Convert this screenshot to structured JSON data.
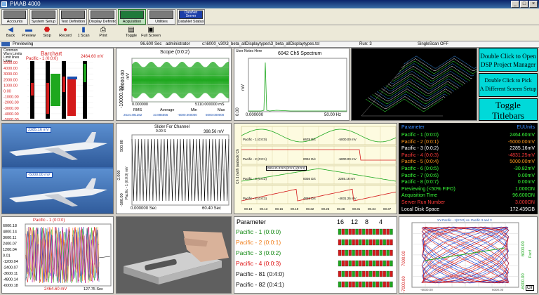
{
  "window": {
    "title": "PIAAB 4000",
    "minimize": "_",
    "maximize": "□",
    "close": "×"
  },
  "nav_buttons": [
    {
      "label": "Accounts"
    },
    {
      "label": "System Setup"
    },
    {
      "label": "Test Definition"
    },
    {
      "label": "Display Definition"
    },
    {
      "label": "Acquisition"
    },
    {
      "label": "Utilities"
    },
    {
      "label": "DataNet Status",
      "badge": "DataNet Server"
    }
  ],
  "toolbar": [
    {
      "label": "Back",
      "icon": "◀"
    },
    {
      "label": "Preview",
      "icon": "▬"
    },
    {
      "label": "Stop",
      "icon": "⬣"
    },
    {
      "label": "Record",
      "icon": "●"
    },
    {
      "label": "1 Scan",
      "icon": "▮"
    },
    {
      "label": "Print",
      "icon": "⎙"
    },
    {
      "label": "Toggle",
      "icon": "▤"
    },
    {
      "label": "Full Screen",
      "icon": "▣"
    }
  ],
  "status": {
    "mode": "Previewing",
    "time": "96.600 Sec",
    "user": "administrator",
    "path": "c:\\6000_v30\\3_beta_allDisplaytypes\\3_beta_allDisplaytypes.tst",
    "run": "Run: 3",
    "single_scan": "SingleScan OFF"
  },
  "barchart": {
    "header": "Common Warn Limits Limit lines Lines",
    "title": "Barchart",
    "channel_label": "Pacific - 1 (0:0:0)",
    "channel_value": "2464.60 mV",
    "y_ticks": [
      "5000.00",
      "4000.00",
      "3000.00",
      "2000.00",
      "1000.00",
      "0.00",
      "-1000.00",
      "-2000.00",
      "-3000.00",
      "-4000.00",
      "-5000.00"
    ]
  },
  "scope": {
    "title": "Scope (0:0:2)",
    "ylabel": "mV",
    "y_top": "10000.00",
    "y_bottom": "-10000.00",
    "x_left": "0.000000",
    "x_right": "5110.000000 mS",
    "stats_labels": [
      "RMS",
      "Average",
      "Min",
      "Max"
    ],
    "stats_values": [
      "2534.491282",
      "10.885556",
      "-5000.000000",
      "5000.000000"
    ]
  },
  "spectrum": {
    "header": "User Notes Here",
    "title": "6042 Ch5 Spectrum",
    "ylabel": "mV",
    "y_ticks": [
      "6000.00",
      "0.00"
    ],
    "x_left": "0.000000",
    "x_right": "50.00 Hz"
  },
  "buttons": {
    "dsp_line1": "Double Click to Open",
    "dsp_line2": "DSP Project Manager",
    "screen_line1": "Double Click to Pick",
    "screen_line2": "A Different Screen Setup",
    "toggle_line1": "Toggle",
    "toggle_line2": "Titlebars"
  },
  "image_panel": {
    "overlay1": "2285.16 mV",
    "overlay2": "-5000.00 mV"
  },
  "slider": {
    "title": "Slider For Channel",
    "y_top": "500.00",
    "y_mid": "-2.000",
    "y_bottom": "-500.00",
    "ylabel": "Pacific - 1 (0:0:0) mV",
    "time_top": "0.00 S",
    "value": "398.56 mV",
    "x_left": "0.000000 Sec",
    "x_right": "60.40 Sec"
  },
  "strip": {
    "ylabel": "Ch 1 (with (aabsol( Ch",
    "rows": [
      {
        "left": "Pacific - 1 (0:0:0)",
        "mid": "6678 D/c",
        "right": "-5000.00 mV"
      },
      {
        "left": "Pacific - 2 (0:0:1)",
        "mid": "0034 D/c",
        "right": "-5000.00 mV"
      },
      {
        "left": "Pacific - 3 (0:0:2)",
        "mid": "0036 D/c",
        "right": "2285.16 mV"
      },
      {
        "left": "Pacific - 4 (0:0:3)",
        "mid": "4833 D/c",
        "right": "-4831.25 mV"
      }
    ],
    "callout": "0034 D 0:0:0 (0:0:1) (0:0:2)",
    "x_ticks": [
      "00.10",
      "00.13",
      "00.16",
      "00.19",
      "00.22",
      "00.25",
      "00.28",
      "00.31",
      "00.34",
      "00.37"
    ]
  },
  "param_table": {
    "header_left": "Parameter",
    "header_right": "EUUnits",
    "rows": [
      {
        "name": "Pacific - 1 (0:0:0)",
        "value": "2464.60mV",
        "color": "#39ff39"
      },
      {
        "name": "Pacific - 2 (0:0:1)",
        "value": "-5000.00mV",
        "color": "#ff9a1f"
      },
      {
        "name": "Pacific - 3 (0:0:2)",
        "value": "2285.16mV",
        "color": "#ffffff"
      },
      {
        "name": "Pacific - 4 (0:0:3)",
        "value": "-4831.25mV",
        "color": "#ff3b3b"
      },
      {
        "name": "Pacific - 5 (0:0:4)",
        "value": "5000.00mV",
        "color": "#ff9a1f"
      },
      {
        "name": "Pacific - 6 (0:0:5)",
        "value": "-30.82mV",
        "color": "#39ff39"
      },
      {
        "name": "Pacific - 7 (0:0:6)",
        "value": "0.00mV",
        "color": "#39ff39"
      },
      {
        "name": "Pacific - 8 (0:0:7)",
        "value": "0.00mV",
        "color": "#39ff39"
      },
      {
        "name": "Previewing (<50% FIFO)",
        "value": "1.000ON",
        "color": "#39ff39"
      },
      {
        "name": "Acquisition Time",
        "value": "96.600ON",
        "color": "#39ff39"
      },
      {
        "name": "Server Run Number",
        "value": "3.000ON",
        "color": "#ff3b3b"
      },
      {
        "name": "Local Disk Space",
        "value": "172.439GB",
        "color": "#ffffff"
      }
    ]
  },
  "timeplot": {
    "title": "Pacific - 1 (0:0:0)",
    "y_ticks": [
      "6000.18",
      "4800.14",
      "3600.11",
      "2400.07",
      "1200.04",
      "0.01",
      "-1200.04",
      "-2400.07",
      "-3600.11",
      "-4800.14",
      "-6000.18"
    ],
    "value": "2464.60 mV",
    "x_right": "127.75 Sec"
  },
  "led_panel": {
    "header": "Parameter",
    "bits": [
      "16",
      "12",
      "8",
      "4"
    ],
    "rows": [
      {
        "name": "Pacific - 1 (0:0:0)",
        "color": "#118811"
      },
      {
        "name": "Pacific - 2 (0:0:1)",
        "color": "#f07e1a"
      },
      {
        "name": "Pacific - 3 (0:0:2)",
        "color": "#118811"
      },
      {
        "name": "Pacific - 4 (0:0:3)",
        "color": "#dd1111"
      },
      {
        "name": "Pacific - 81 (0:4:0)",
        "color": "#111111"
      },
      {
        "name": "Pacific - 82 (0:4:1)",
        "color": "#111111"
      }
    ],
    "y_top": "7000.00",
    "y_bottom": "-7000.00"
  },
  "xy": {
    "title": "XY-Pacific - 1(0:0:0) vs. Pacific 3 and 3",
    "y_right_top": "6000.00",
    "y_right_bottom": "-6000.00",
    "side_label": "Pacif",
    "clr": "Clr",
    "x_left": "-6000.00",
    "x_right": "6000.00"
  }
}
